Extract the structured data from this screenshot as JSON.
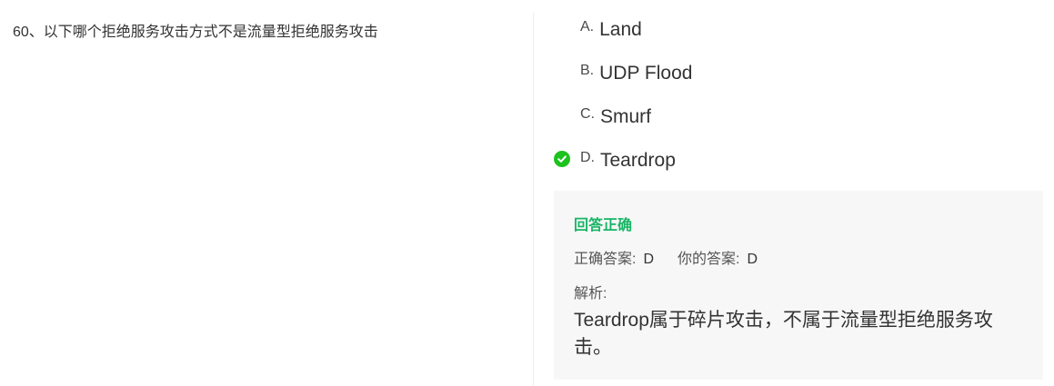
{
  "question": {
    "text": "60、以下哪个拒绝服务攻击方式不是流量型拒绝服务攻击"
  },
  "options": [
    {
      "letter": "A.",
      "text": "Land"
    },
    {
      "letter": "B.",
      "text": "UDP Flood"
    },
    {
      "letter": "C.",
      "text": "Smurf"
    },
    {
      "letter": "D.",
      "text": "Teardrop"
    }
  ],
  "selected_icon": "check-circle-icon",
  "colors": {
    "correct": "#18b566",
    "check": "#1ec21e",
    "panel_bg": "#f7f7f7"
  },
  "result": {
    "title": "回答正确",
    "correct_label": "正确答案:",
    "correct_value": "D",
    "your_label": "你的答案:",
    "your_value": "D",
    "analysis_label": "解析:",
    "analysis_text": "Teardrop属于碎片攻击，不属于流量型拒绝服务攻击。"
  }
}
